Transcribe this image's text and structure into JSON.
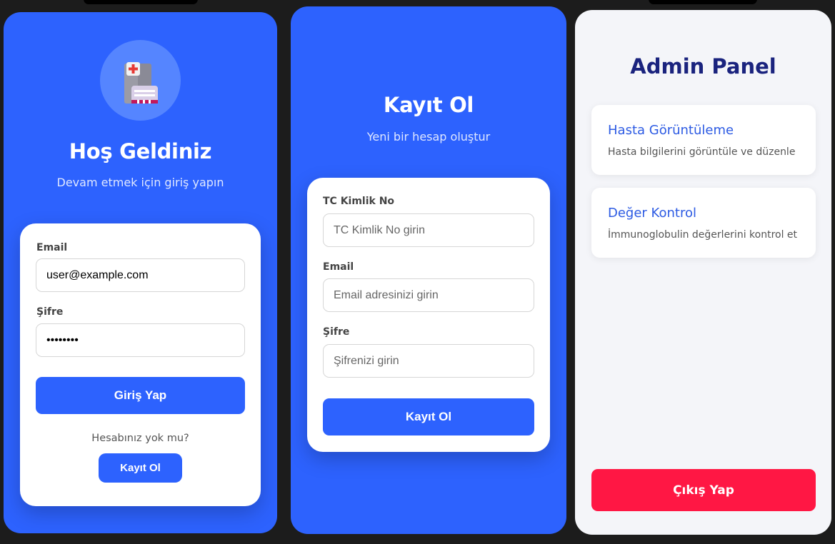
{
  "login": {
    "title": "Hoş Geldiniz",
    "subtitle": "Devam etmek için giriş yapın",
    "email_label": "Email",
    "email_value": "user@example.com",
    "password_label": "Şifre",
    "password_value": "password",
    "submit_label": "Giriş Yap",
    "no_account_text": "Hesabınız yok mu?",
    "register_link_label": "Kayıt Ol"
  },
  "register": {
    "title": "Kayıt Ol",
    "subtitle": "Yeni bir hesap oluştur",
    "tc_label": "TC Kimlik No",
    "tc_placeholder": "TC Kimlik No girin",
    "email_label": "Email",
    "email_placeholder": "Email adresinizi girin",
    "password_label": "Şifre",
    "password_placeholder": "Şifrenizi girin",
    "submit_label": "Kayıt Ol"
  },
  "admin": {
    "title": "Admin Panel",
    "menu": [
      {
        "title": "Hasta Görüntüleme",
        "description": "Hasta bilgilerini görüntüle ve düzenle"
      },
      {
        "title": "Değer Kontrol",
        "description": "İmmunoglobulin değerlerini kontrol et"
      }
    ],
    "logout_label": "Çıkış Yap"
  },
  "colors": {
    "primary": "#2d62fe",
    "danger": "#ff1744",
    "admin_title": "#1a237e",
    "background": "#1c1c1c"
  },
  "icons": {
    "logo": "hospital-icon"
  }
}
